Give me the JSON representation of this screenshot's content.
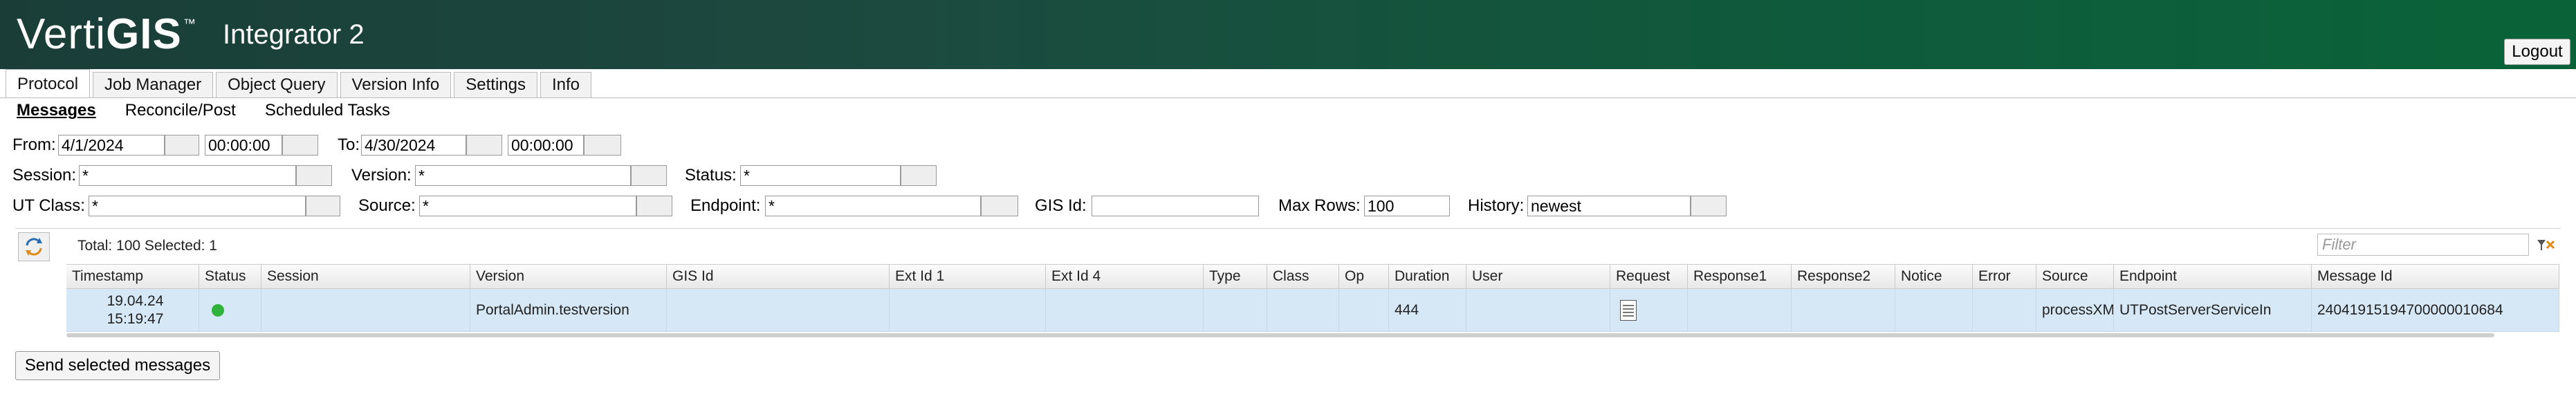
{
  "header": {
    "logo_regular": "Verti",
    "logo_bold": "GIS",
    "logo_tm": "™",
    "app_title": "Integrator 2",
    "logout_label": "Logout"
  },
  "tabs": [
    {
      "label": "Protocol",
      "active": true
    },
    {
      "label": "Job Manager"
    },
    {
      "label": "Object Query"
    },
    {
      "label": "Version Info"
    },
    {
      "label": "Settings"
    },
    {
      "label": "Info"
    }
  ],
  "subtabs": [
    {
      "label": "Messages",
      "active": true
    },
    {
      "label": "Reconcile/Post"
    },
    {
      "label": "Scheduled Tasks"
    }
  ],
  "filters": {
    "from_label": "From:",
    "from_date": "4/1/2024",
    "from_time": "00:00:00",
    "to_label": "To:",
    "to_date": "4/30/2024",
    "to_time": "00:00:00",
    "session_label": "Session:",
    "session_value": "*",
    "version_label": "Version:",
    "version_value": "*",
    "status_label": "Status:",
    "status_value": "*",
    "utclass_label": "UT Class:",
    "utclass_value": "*",
    "source_label": "Source:",
    "source_value": "*",
    "endpoint_label": "Endpoint:",
    "endpoint_value": "*",
    "gisid_label": "GIS Id:",
    "gisid_value": "",
    "maxrows_label": "Max Rows:",
    "maxrows_value": "100",
    "history_label": "History:",
    "history_value": "newest"
  },
  "grid": {
    "total_text": "Total: 100 Selected: 1",
    "filter_placeholder": "Filter",
    "columns": [
      "Timestamp",
      "Status",
      "Session",
      "Version",
      "GIS Id",
      "Ext Id 1",
      "Ext Id 4",
      "Type",
      "Class",
      "Op",
      "Duration",
      "User",
      "Request",
      "Response1",
      "Response2",
      "Notice",
      "Error",
      "Source",
      "Endpoint",
      "Message Id"
    ],
    "rows": [
      {
        "timestamp_date": "19.04.24",
        "timestamp_time": "15:19:47",
        "status_color": "#2fb33a",
        "session": "",
        "version": "PortalAdmin.testversion",
        "gis_id": "",
        "ext_id_1": "",
        "ext_id_4": "",
        "type": "",
        "class": "",
        "op": "",
        "duration": "444",
        "user": "",
        "request_icon": "document-icon",
        "response1": "",
        "response2": "",
        "notice": "",
        "error": "",
        "source": "processXM",
        "endpoint": "UTPostServerServiceIn",
        "message_id": "24041915194700000010684"
      }
    ]
  },
  "actions": {
    "send_label": "Send selected messages"
  }
}
